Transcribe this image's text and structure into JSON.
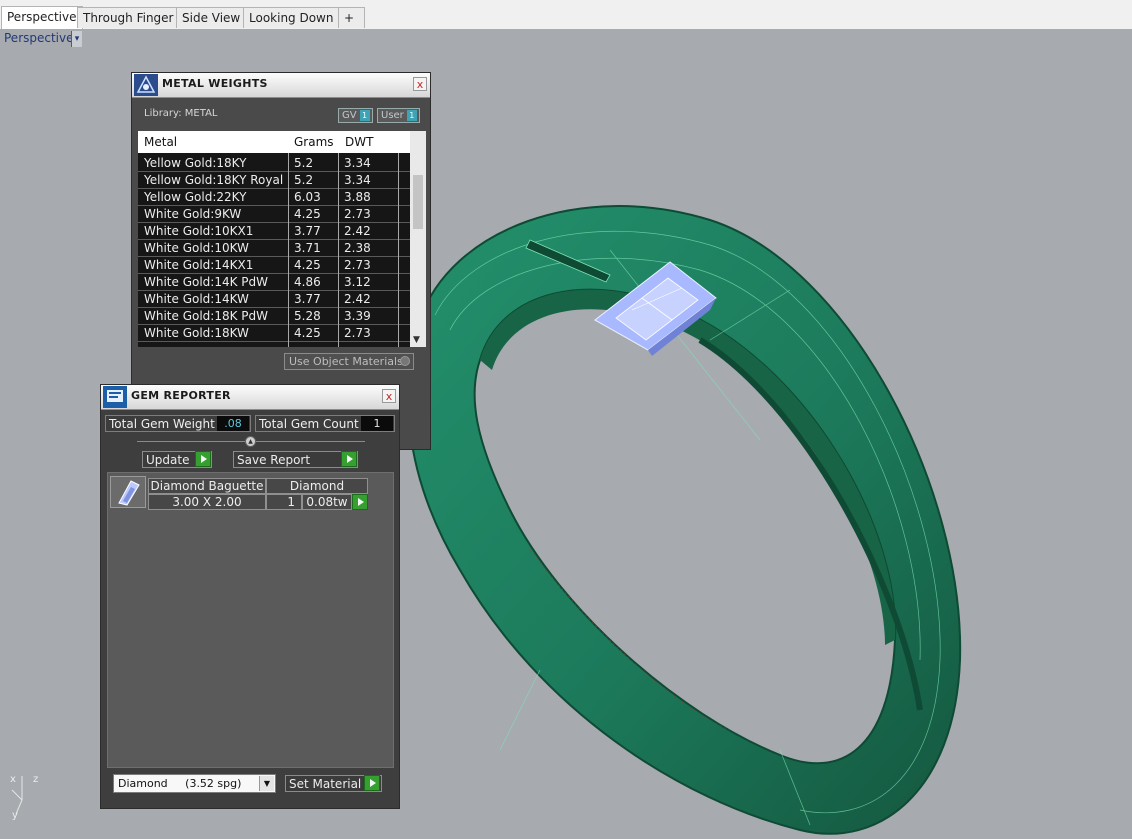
{
  "tabs": [
    {
      "label": "Perspective",
      "active": true
    },
    {
      "label": "Through Finger",
      "active": false
    },
    {
      "label": "Side View",
      "active": false
    },
    {
      "label": "Looking Down",
      "active": false
    }
  ],
  "tab_add_label": "+",
  "viewport": {
    "label": "Perspective",
    "dropdown_glyph": "▾"
  },
  "metal_weights": {
    "title": "METAL WEIGHTS",
    "close": "x",
    "library_label": "Library: METAL",
    "gv_label": "GV",
    "user_label": "User",
    "toggle_indicator": "1",
    "columns": [
      "Metal",
      "Grams",
      "DWT"
    ],
    "rows": [
      {
        "metal": "Yellow Gold:18KY",
        "grams": "5.2",
        "dwt": "3.34"
      },
      {
        "metal": "Yellow Gold:18KY Royal",
        "grams": "5.2",
        "dwt": "3.34"
      },
      {
        "metal": "Yellow Gold:22KY",
        "grams": "6.03",
        "dwt": "3.88"
      },
      {
        "metal": "White Gold:9KW",
        "grams": "4.25",
        "dwt": "2.73"
      },
      {
        "metal": "White Gold:10KX1",
        "grams": "3.77",
        "dwt": "2.42"
      },
      {
        "metal": "White Gold:10KW",
        "grams": "3.71",
        "dwt": "2.38"
      },
      {
        "metal": "White Gold:14KX1",
        "grams": "4.25",
        "dwt": "2.73"
      },
      {
        "metal": "White Gold:14K PdW",
        "grams": "4.86",
        "dwt": "3.12"
      },
      {
        "metal": "White Gold:14KW",
        "grams": "3.77",
        "dwt": "2.42"
      },
      {
        "metal": "White Gold:18K PdW",
        "grams": "5.28",
        "dwt": "3.39"
      },
      {
        "metal": "White Gold:18KW",
        "grams": "4.25",
        "dwt": "2.73"
      }
    ],
    "use_object_materials_label": "Use Object Materials"
  },
  "gem_reporter": {
    "title": "GEM REPORTER",
    "close": "x",
    "total_weight_label": "Total Gem Weight",
    "total_weight_value": ".08",
    "total_count_label": "Total Gem Count",
    "total_count_value": "1",
    "update_label": "Update",
    "save_report_label": "Save Report",
    "gems": [
      {
        "shape": "Diamond Baguette",
        "material": "Diamond",
        "size": "3.00 X 2.00",
        "count": "1",
        "weight": "0.08tw"
      }
    ],
    "material_select": "Diamond     (3.52 spg)",
    "set_material_label": "Set Material"
  },
  "axis_labels": {
    "z": "z",
    "x": "x",
    "y": "y"
  },
  "colors": {
    "ring": "#1f7a5c",
    "ring_wire": "#7de6b7",
    "gem": "#a9b9ff",
    "accent_green": "#35a030",
    "value_cyan": "#5ec8e0"
  }
}
